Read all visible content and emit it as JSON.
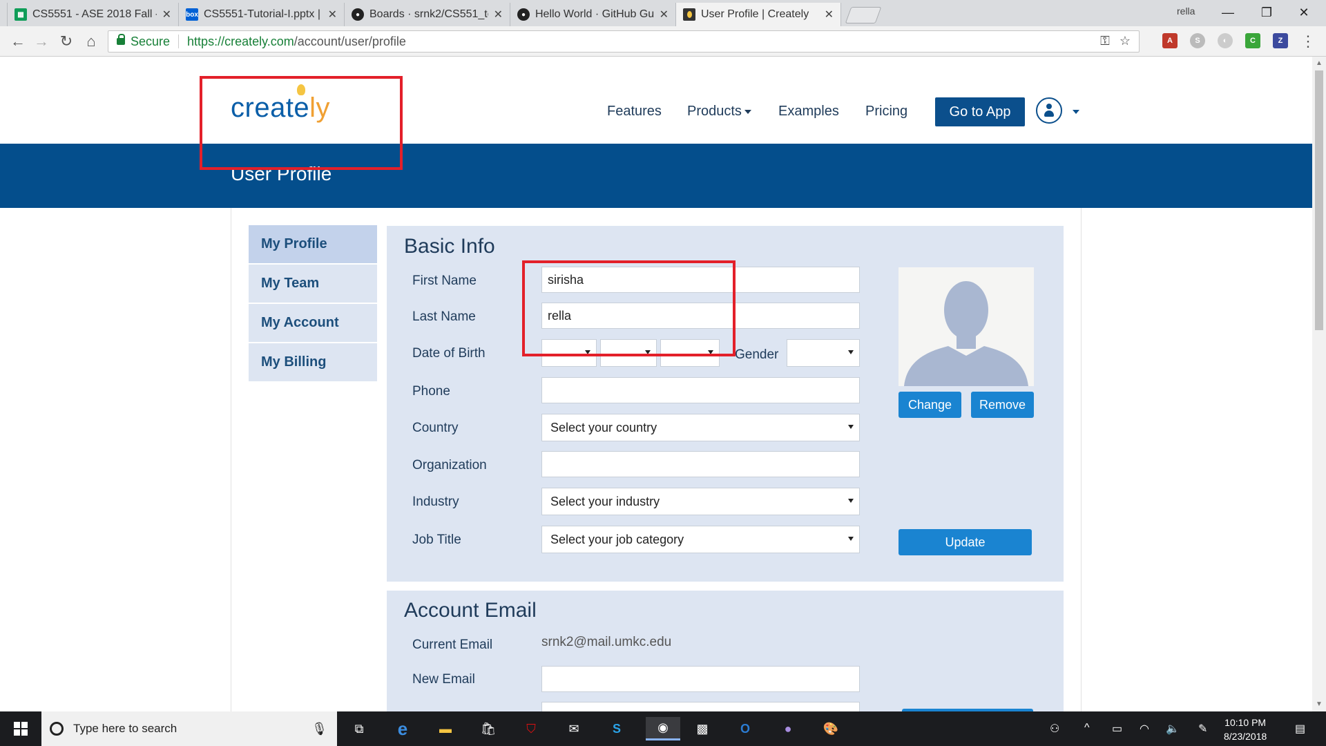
{
  "browser": {
    "tabs": [
      {
        "title": "CS5551 - ASE 2018 Fall -",
        "icon": "google-sheets-icon",
        "active": false
      },
      {
        "title": "CS5551-Tutorial-I.pptx | P",
        "icon": "box-icon",
        "active": false
      },
      {
        "title": "Boards · srnk2/CS551_tea",
        "icon": "github-icon",
        "active": false
      },
      {
        "title": "Hello World · GitHub Gui",
        "icon": "github-icon",
        "active": false
      },
      {
        "title": "User Profile | Creately",
        "icon": "creately-icon",
        "active": true
      }
    ],
    "profile_name": "rella",
    "secure_label": "Secure",
    "url_host": "https://creately.com",
    "url_path": "/account/user/profile"
  },
  "site": {
    "logo_main": "create",
    "logo_tail": "ly",
    "nav": {
      "features": "Features",
      "products": "Products",
      "examples": "Examples",
      "pricing": "Pricing"
    },
    "go_to_app": "Go to App",
    "page_title": "User Profile"
  },
  "sidebar": {
    "items": [
      {
        "label": "My Profile",
        "active": true
      },
      {
        "label": "My Team",
        "active": false
      },
      {
        "label": "My Account",
        "active": false
      },
      {
        "label": "My Billing",
        "active": false
      }
    ]
  },
  "basic_info": {
    "heading": "Basic Info",
    "first_name_label": "First Name",
    "first_name_value": "sirisha",
    "last_name_label": "Last Name",
    "last_name_value": "rella",
    "dob_label": "Date of Birth",
    "gender_label": "Gender",
    "phone_label": "Phone",
    "country_label": "Country",
    "country_value": "Select your country",
    "organization_label": "Organization",
    "industry_label": "Industry",
    "industry_value": "Select your industry",
    "job_title_label": "Job Title",
    "job_title_value": "Select your job category",
    "change_button": "Change",
    "remove_button": "Remove",
    "update_button": "Update"
  },
  "account_email": {
    "heading": "Account Email",
    "current_email_label": "Current Email",
    "current_email_value": "srnk2@mail.umkc.edu",
    "new_email_label": "New Email"
  },
  "taskbar": {
    "search_placeholder": "Type here to search",
    "time": "10:10 PM",
    "date": "8/23/2018"
  },
  "colors": {
    "brand_blue": "#044e8c",
    "panel_bg": "#dde5f2",
    "button_blue": "#1a84d1",
    "highlight_red": "#e3202a"
  }
}
